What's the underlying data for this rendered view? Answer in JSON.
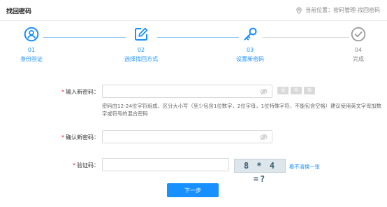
{
  "header": {
    "title": "找回密码",
    "location_label": "当前位置：",
    "location_path": "密码管理-找回密码"
  },
  "steps": [
    {
      "number": "01",
      "label": "身份验证",
      "icon": "user-icon",
      "status": "active"
    },
    {
      "number": "02",
      "label": "选择找回方式",
      "icon": "edit-icon",
      "status": "active"
    },
    {
      "number": "03",
      "label": "设置新密码",
      "icon": "key-icon",
      "status": "active"
    },
    {
      "number": "04",
      "label": "完成",
      "icon": "check-circle-icon",
      "status": "pending"
    }
  ],
  "form": {
    "new_password": {
      "label": "输入新密码：",
      "value": "",
      "placeholder": ""
    },
    "strength": [
      "弱",
      "中",
      "强"
    ],
    "hint": "密码由12-24位字符组成，区分大小写（至少包含1位数字，2位字母，1位特殊字符，不能包含空格）建议使用英文字母加数字或符号的混合密码",
    "confirm_password": {
      "label": "确认新密码：",
      "value": "",
      "placeholder": ""
    },
    "captcha": {
      "label": "验证码：",
      "value": "",
      "placeholder": "",
      "image_text": "8 * 4 =?",
      "refresh_label": "看不清换一张"
    }
  },
  "next_button": "下一步",
  "colors": {
    "accent": "#1890ff",
    "required": "#f5222d",
    "line_active": "#8fc6f5",
    "line_pending": "#d9d9d9"
  }
}
